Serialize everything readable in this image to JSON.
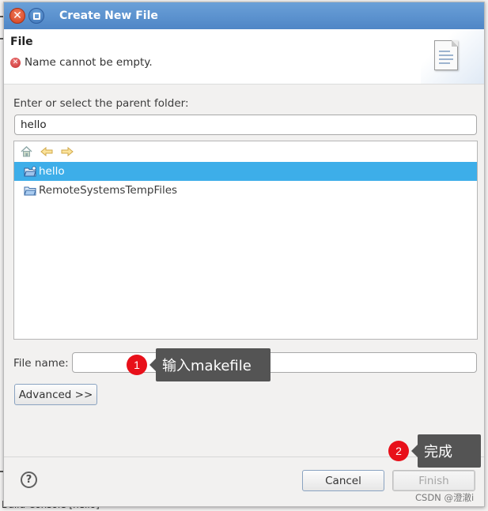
{
  "window": {
    "title": "Create New File"
  },
  "banner": {
    "title": "File",
    "error_message": "Name cannot be empty."
  },
  "parent_folder": {
    "label": "Enter or select the parent folder:",
    "value": "hello"
  },
  "tree": {
    "items": [
      {
        "label": "hello",
        "selected": true
      },
      {
        "label": "RemoteSystemsTempFiles",
        "selected": false
      }
    ]
  },
  "file_name": {
    "label": "File name:",
    "value": ""
  },
  "buttons": {
    "advanced": "Advanced >>",
    "cancel": "Cancel",
    "finish": "Finish"
  },
  "annotations": [
    {
      "number": "1",
      "text": "输入makefile"
    },
    {
      "number": "2",
      "text": "完成"
    }
  ],
  "background": {
    "bottom_text": "Build Console [hello]"
  },
  "watermark": "CSDN @澄澈i",
  "colors": {
    "titlebar": "#5a8fcf",
    "selection": "#3daee9",
    "badge": "#e8101a",
    "callout": "#545454"
  }
}
